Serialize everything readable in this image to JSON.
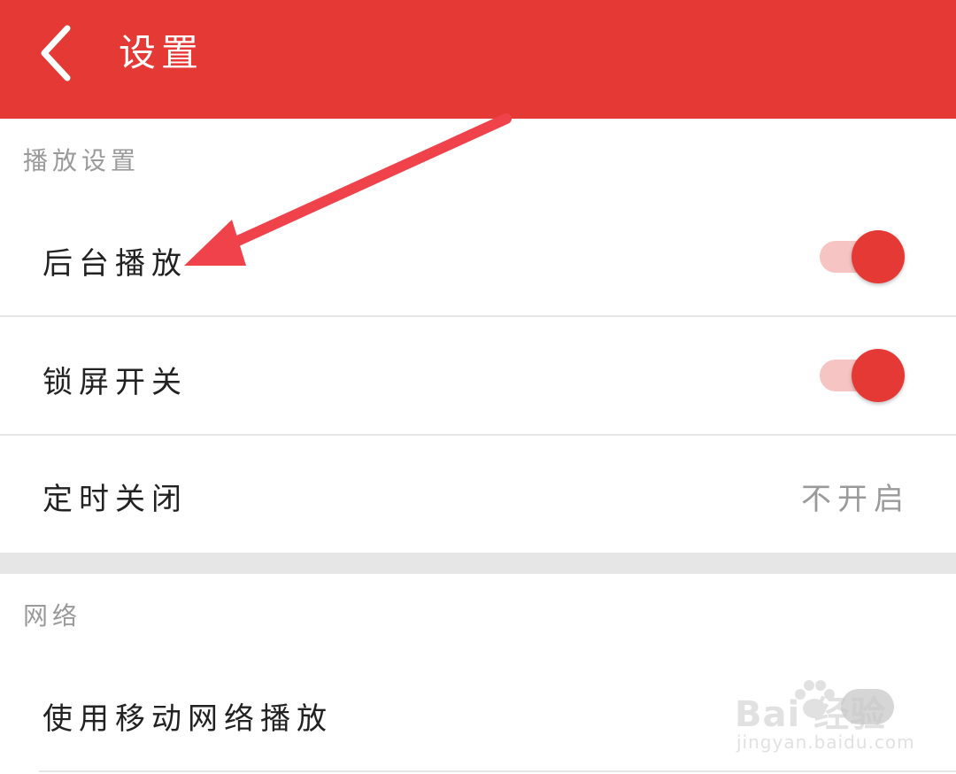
{
  "header": {
    "title": "设置",
    "back_icon": "chevron-left-icon"
  },
  "sections": [
    {
      "label": "播放设置",
      "rows": [
        {
          "label": "后台播放",
          "control": "toggle",
          "checked": true
        },
        {
          "label": "锁屏开关",
          "control": "toggle",
          "checked": true
        },
        {
          "label": "定时关闭",
          "control": "value",
          "value": "不开启"
        }
      ]
    },
    {
      "label": "网络",
      "rows": [
        {
          "label": "使用移动网络播放",
          "control": "toggle",
          "checked": false
        }
      ]
    }
  ],
  "watermark": {
    "brand": "Bai  经验",
    "url": "jingyan.baidu.com"
  },
  "colors": {
    "header": "#e53935",
    "toggle_on_thumb": "#e53935",
    "toggle_on_track": "#f6c4c2",
    "annotation_arrow": "#f0424a",
    "section_label": "#9a9a9a"
  }
}
